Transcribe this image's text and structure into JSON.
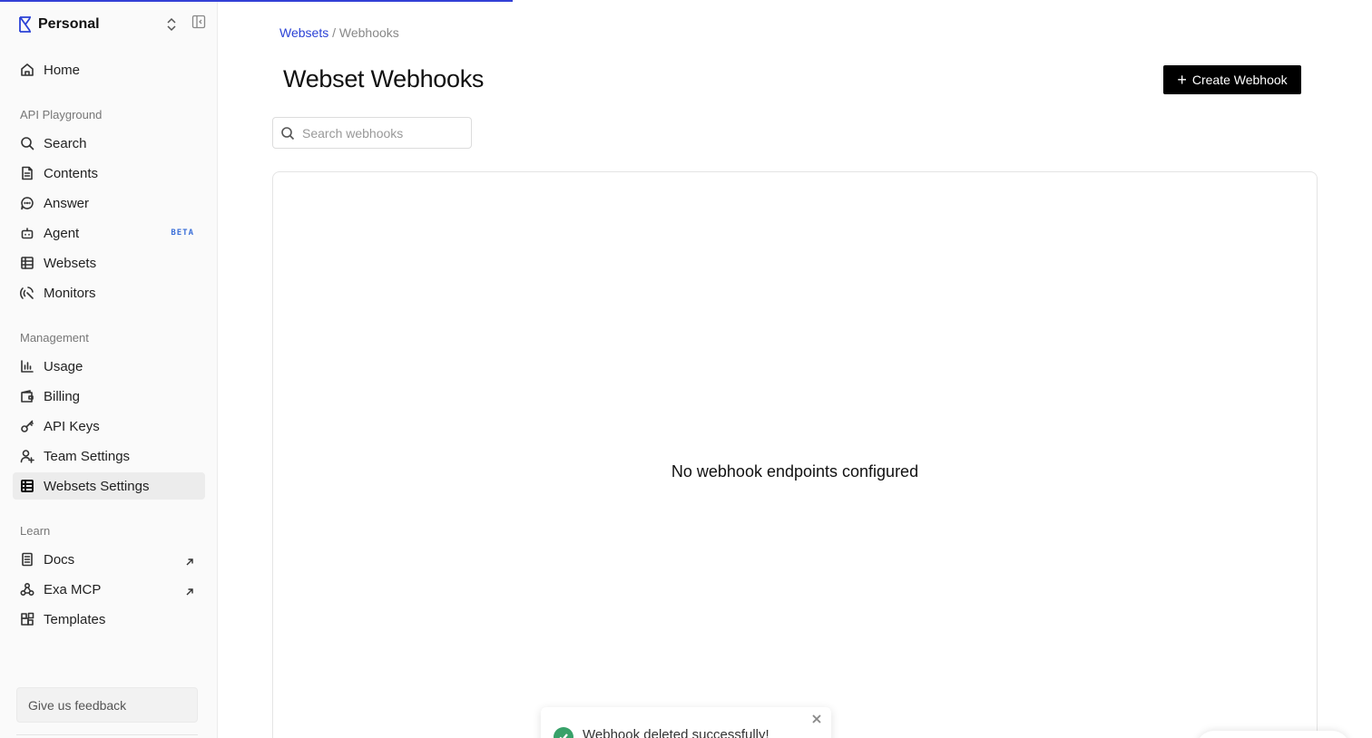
{
  "page_load_progress": 0.374,
  "colors": {
    "accent": "#2b42d6",
    "progress": "#3340d6",
    "primary_button_bg": "#000000",
    "success": "#38a169",
    "beta": "#3b6fd8"
  },
  "sidebar": {
    "brand": {
      "name": "Personal",
      "logo_icon": "exa-logo-icon"
    },
    "home": {
      "label": "Home",
      "icon": "home-icon"
    },
    "sections": {
      "api_playground": {
        "title": "API Playground",
        "items": [
          {
            "label": "Search",
            "icon": "search-icon"
          },
          {
            "label": "Contents",
            "icon": "document-icon"
          },
          {
            "label": "Answer",
            "icon": "chat-bubble-icon"
          },
          {
            "label": "Agent",
            "icon": "robot-icon",
            "badge": "BETA"
          },
          {
            "label": "Websets",
            "icon": "table-icon"
          },
          {
            "label": "Monitors",
            "icon": "radar-icon"
          }
        ]
      },
      "management": {
        "title": "Management",
        "items": [
          {
            "label": "Usage",
            "icon": "bar-chart-icon"
          },
          {
            "label": "Billing",
            "icon": "wallet-icon"
          },
          {
            "label": "API Keys",
            "icon": "key-icon"
          },
          {
            "label": "Team Settings",
            "icon": "user-plus-icon"
          },
          {
            "label": "Websets Settings",
            "icon": "table-icon",
            "active": true
          }
        ]
      },
      "learn": {
        "title": "Learn",
        "items": [
          {
            "label": "Docs",
            "icon": "book-icon",
            "external": true
          },
          {
            "label": "Exa MCP",
            "icon": "webhook-icon",
            "external": true
          },
          {
            "label": "Templates",
            "icon": "templates-icon"
          }
        ]
      }
    },
    "feedback_label": "Give us feedback"
  },
  "main": {
    "breadcrumb": {
      "parent": "Websets",
      "separator": " / ",
      "current": "Webhooks"
    },
    "title": "Webset Webhooks",
    "create_button": {
      "icon": "plus-icon",
      "label": "Create Webhook"
    },
    "search": {
      "placeholder": "Search webhooks",
      "value": ""
    },
    "empty_message": "No webhook endpoints configured"
  },
  "toast": {
    "message": "Webhook deleted successfully!",
    "icon": "check-circle-icon"
  }
}
